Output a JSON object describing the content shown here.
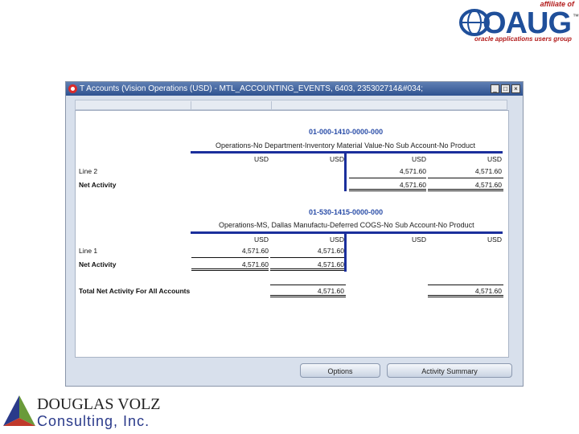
{
  "logos": {
    "oaug": {
      "affiliate": "affiliate of",
      "word": "OAUG",
      "tm": "™",
      "tagline": "oracle applications users group"
    },
    "douglas_volz": {
      "line1": "DOUGLAS VOLZ",
      "line2": "Consulting, Inc."
    }
  },
  "window": {
    "title": "T Accounts (Vision Operations (USD) - MTL_ACCOUNTING_EVENTS, 6403, 235302714&#034;",
    "controls": {
      "minimize": "_",
      "maximize": "□",
      "close": "×"
    }
  },
  "sections": [
    {
      "account": "01-000-1410-0000-000",
      "description": "Operations-No Department-Inventory Material Value-No Sub Account-No Product",
      "col_headers": [
        "USD",
        "USD",
        "USD",
        "USD"
      ],
      "rows": [
        {
          "label": "Line 2",
          "values": [
            "",
            "",
            "4,571.60",
            "4,571.60"
          ]
        },
        {
          "label": "Net Activity",
          "values": [
            "",
            "",
            "4,571.60",
            "4,571.60"
          ]
        }
      ]
    },
    {
      "account": "01-530-1415-0000-000",
      "description": "Operations-MS, Dallas Manufactu-Deferred COGS-No Sub Account-No Product",
      "col_headers": [
        "USD",
        "USD",
        "USD",
        "USD"
      ],
      "rows": [
        {
          "label": "Line 1",
          "values": [
            "4,571.60",
            "4,571.60",
            "",
            ""
          ]
        },
        {
          "label": "Net Activity",
          "values": [
            "4,571.60",
            "4,571.60",
            "",
            ""
          ]
        }
      ]
    }
  ],
  "total": {
    "label": "Total Net Activity For All Accounts",
    "values": [
      "",
      "4,571.60",
      "",
      "4,571.60"
    ]
  },
  "buttons": {
    "options": "Options",
    "activity_summary": "Activity Summary"
  }
}
